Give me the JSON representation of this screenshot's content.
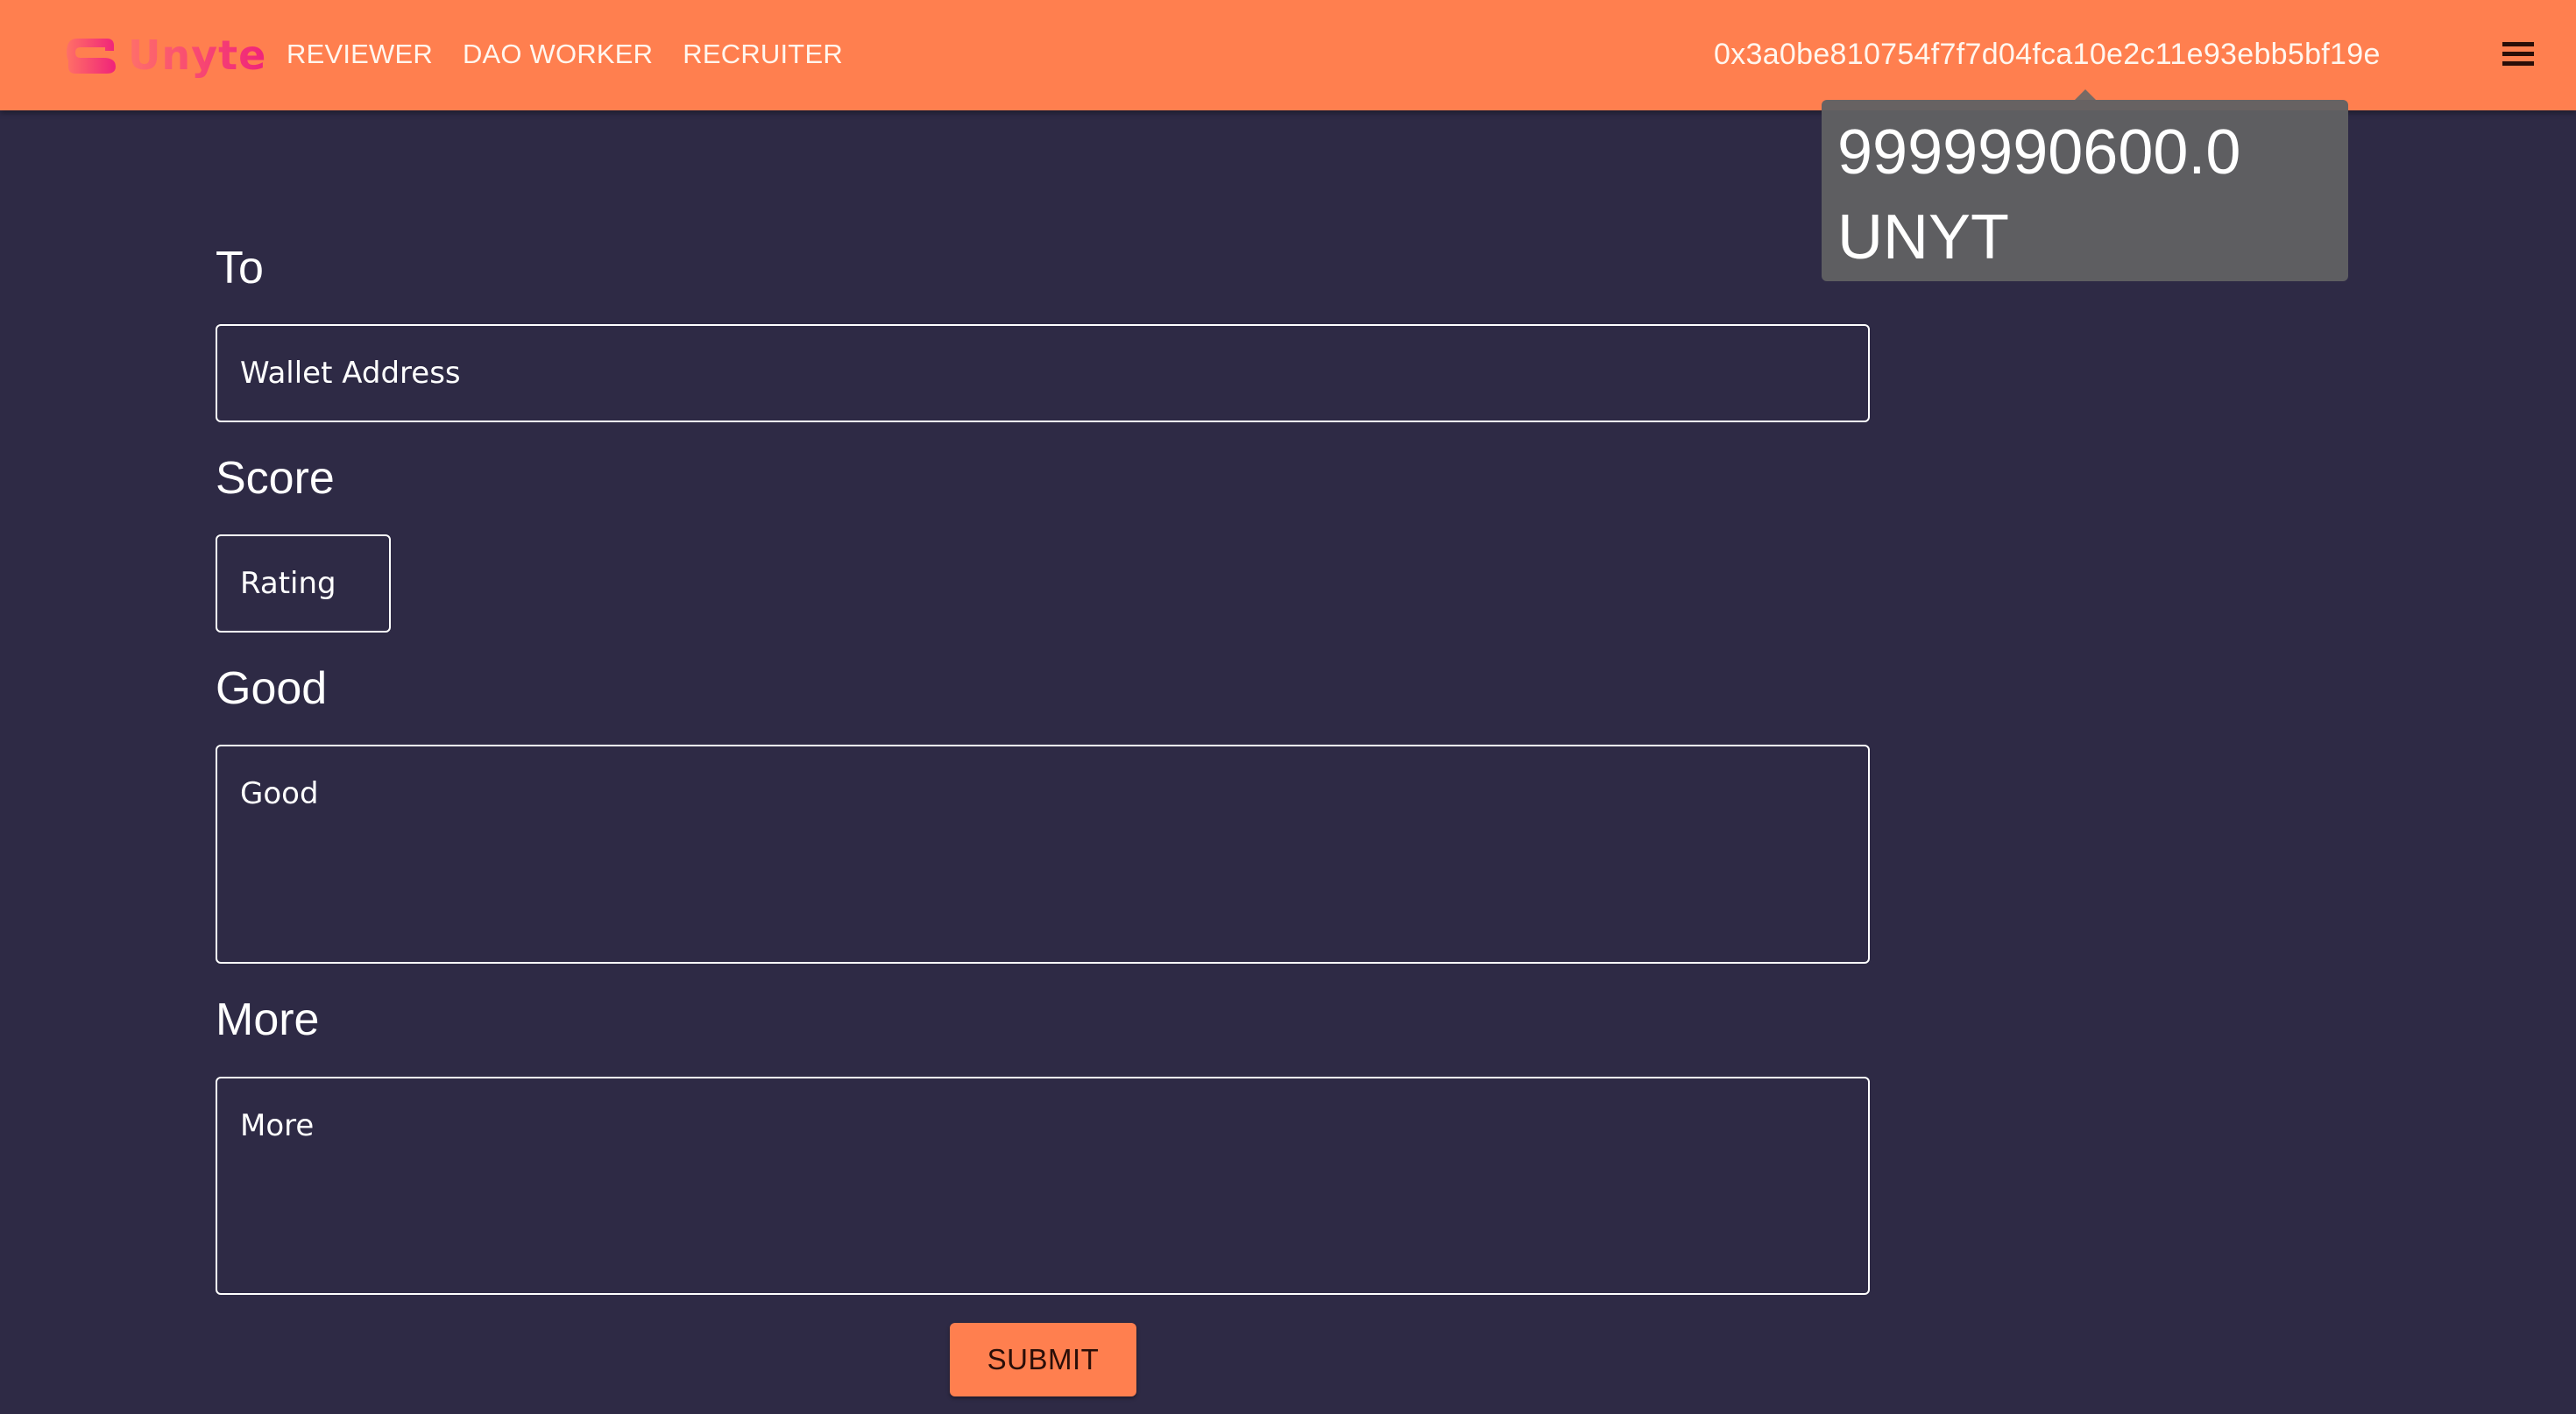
{
  "header": {
    "brand": "Unyte",
    "nav": [
      "REVIEWER",
      "DAO WORKER",
      "RECRUITER"
    ],
    "wallet_address": "0x3a0be810754f7f7d04fca10e2c11e93ebb5bf19e",
    "menu_icon": "hamburger-menu-icon"
  },
  "tooltip": {
    "balance": "9999990600.0",
    "unit": "UNYT"
  },
  "form": {
    "to_label": "To",
    "to_placeholder": "Wallet Address",
    "score_label": "Score",
    "score_placeholder": "Rating",
    "good_label": "Good",
    "good_placeholder": "Good",
    "more_label": "More",
    "more_placeholder": "More",
    "submit_label": "SUBMIT"
  },
  "colors": {
    "header_bg": "#ff7f4f",
    "page_bg": "#2e2a45",
    "accent": "#ff7f4f",
    "tooltip_bg": "#616163",
    "logo_gradient": [
      "#ff6f6a",
      "#f0237a"
    ]
  }
}
